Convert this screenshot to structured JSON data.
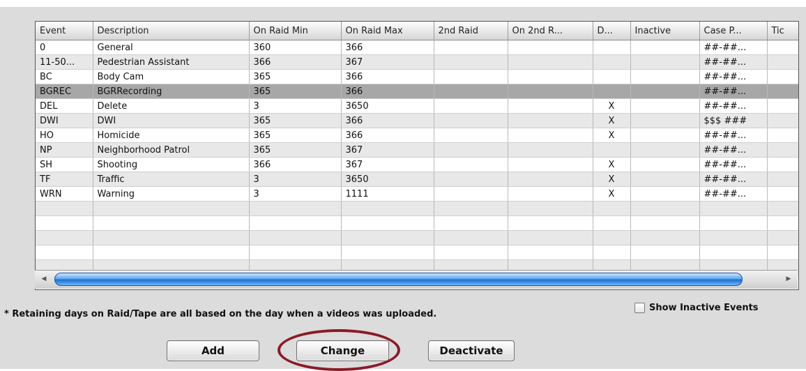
{
  "grid": {
    "columns": [
      "Event",
      "Description",
      "On Raid Min",
      "On Raid Max",
      "2nd Raid",
      "On 2nd R...",
      "D...",
      "Inactive",
      "Case P...",
      "Tic"
    ],
    "rows": [
      [
        "0",
        "General",
        "360",
        "366",
        "",
        "",
        "",
        "",
        "##-##..."
      ],
      [
        "11-50...",
        "Pedestrian Assistant",
        "366",
        "367",
        "",
        "",
        "",
        "",
        "##-##..."
      ],
      [
        "BC",
        "Body Cam",
        "365",
        "366",
        "",
        "",
        "",
        "",
        "##-##..."
      ],
      [
        "BGREC",
        "BGRRecording",
        "365",
        "366",
        "",
        "",
        "",
        "",
        "##-##..."
      ],
      [
        "DEL",
        "Delete",
        "3",
        "3650",
        "",
        "",
        "X",
        "",
        "##-##..."
      ],
      [
        "DWI",
        "DWI",
        "365",
        "366",
        "",
        "",
        "X",
        "",
        "$$$ ###"
      ],
      [
        "HO",
        "Homicide",
        "365",
        "366",
        "",
        "",
        "X",
        "",
        "##-##..."
      ],
      [
        "NP",
        "Neighborhood Patrol",
        "365",
        "367",
        "",
        "",
        "",
        "",
        "##-##..."
      ],
      [
        "SH",
        "Shooting",
        "366",
        "367",
        "",
        "",
        "X",
        "",
        "##-##..."
      ],
      [
        "TF",
        "Traffic",
        "3",
        "3650",
        "",
        "",
        "X",
        "",
        "##-##..."
      ],
      [
        "WRN",
        "Warning",
        "3",
        "1111",
        "",
        "",
        "X",
        "",
        "##-##..."
      ]
    ],
    "selected_row": 3
  },
  "icons": {
    "scroll_left": "scroll-left-arrow-icon",
    "scroll_right": "scroll-right-arrow-icon"
  },
  "note": "* Retaining days on Raid/Tape are all based on the day when a videos was uploaded.",
  "show_inactive": {
    "label": "Show Inactive Events",
    "checked": false
  },
  "buttons": {
    "add": "Add",
    "change": "Change",
    "deactivate": "Deactivate"
  },
  "colors": {
    "highlight_ring": "#8b1a27",
    "selected_row": "#a7a7a7",
    "scroll_thumb": "#1e6fd0"
  }
}
